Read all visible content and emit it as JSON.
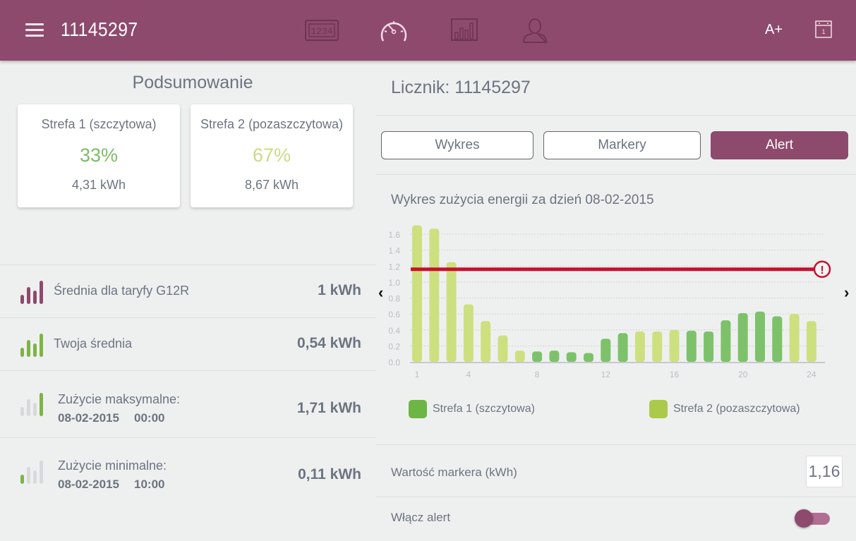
{
  "header": {
    "title": "11145297",
    "menu_icon": "hamburger-icon",
    "nav_icons": [
      "meter-display-icon",
      "speedometer-icon",
      "bar-chart-icon",
      "user-icon"
    ],
    "active_nav": "speedometer-icon",
    "font_size_label": "A+",
    "calendar_icon": "calendar-icon",
    "calendar_day": "1"
  },
  "summary": {
    "title": "Podsumowanie",
    "cards": [
      {
        "label": "Strefa 1 (szczytowa)",
        "percent": "33%",
        "value": "4,31 kWh",
        "color": "#7dbd66"
      },
      {
        "label": "Strefa 2 (pozaszczytowa)",
        "percent": "67%",
        "value": "8,67 kWh",
        "color": "#c8dd84"
      }
    ],
    "stats": [
      {
        "label": "Średnia dla taryfy G12R",
        "value": "1 kWh"
      },
      {
        "label": "Twoja średnia",
        "value": "0,54 kWh"
      },
      {
        "label": "Zużycie maksymalne:",
        "date": "08-02-2015",
        "time": "00:00",
        "value": "1,71 kWh"
      },
      {
        "label": "Zużycie minimalne:",
        "date": "08-02-2015",
        "time": "10:00",
        "value": "0,11 kWh"
      }
    ]
  },
  "meter": {
    "title": "Licznik: 11145297",
    "tabs": [
      {
        "label": "Wykres",
        "active": false
      },
      {
        "label": "Markery",
        "active": false
      },
      {
        "label": "Alert",
        "active": true
      }
    ],
    "chart_title": "Wykres zużycia energii za dzień 08-02-2015",
    "prev_arrow": "‹",
    "next_arrow": "›",
    "marker_label": "Wartość markera (kWh)",
    "marker_value": "1,16",
    "alert_label": "Włącz alert",
    "alert_enabled": true
  },
  "colors": {
    "brand": "#8e4a6d",
    "zone1": "#7dc26a",
    "zone2": "#cde07f",
    "alert_line": "#c8102e"
  },
  "chart_data": {
    "type": "bar",
    "title": "Wykres zużycia energii za dzień 08-02-2015",
    "xlabel": "",
    "ylabel": "",
    "x": [
      1,
      2,
      3,
      4,
      5,
      6,
      7,
      8,
      9,
      10,
      11,
      12,
      13,
      14,
      15,
      16,
      17,
      18,
      19,
      20,
      21,
      22,
      23,
      24
    ],
    "x_tick_labels": [
      "1",
      "4",
      "8",
      "12",
      "16",
      "20",
      "24"
    ],
    "y_tick_labels": [
      "0.0",
      "0.2",
      "0.4",
      "0.6",
      "0.8",
      "1.0",
      "1.2",
      "1.4",
      "1.6"
    ],
    "ylim": [
      0,
      1.7
    ],
    "grid": true,
    "values": [
      1.71,
      1.67,
      1.25,
      0.72,
      0.51,
      0.33,
      0.14,
      0.13,
      0.14,
      0.12,
      0.11,
      0.29,
      0.36,
      0.38,
      0.38,
      0.4,
      0.39,
      0.38,
      0.52,
      0.61,
      0.63,
      0.57,
      0.6,
      0.51
    ],
    "zone": [
      2,
      2,
      2,
      2,
      2,
      2,
      2,
      1,
      1,
      1,
      1,
      1,
      1,
      2,
      2,
      2,
      1,
      1,
      1,
      1,
      1,
      1,
      2,
      2
    ],
    "series": [
      {
        "name": "Strefa 1 (szczytowa)",
        "color": "#7dc26a"
      },
      {
        "name": "Strefa 2 (pozaszczytowa)",
        "color": "#cde07f"
      }
    ],
    "legend_swatches": [
      "#6db545",
      "#abc94a"
    ],
    "alert_threshold": 1.16,
    "legend_position": "bottom"
  }
}
